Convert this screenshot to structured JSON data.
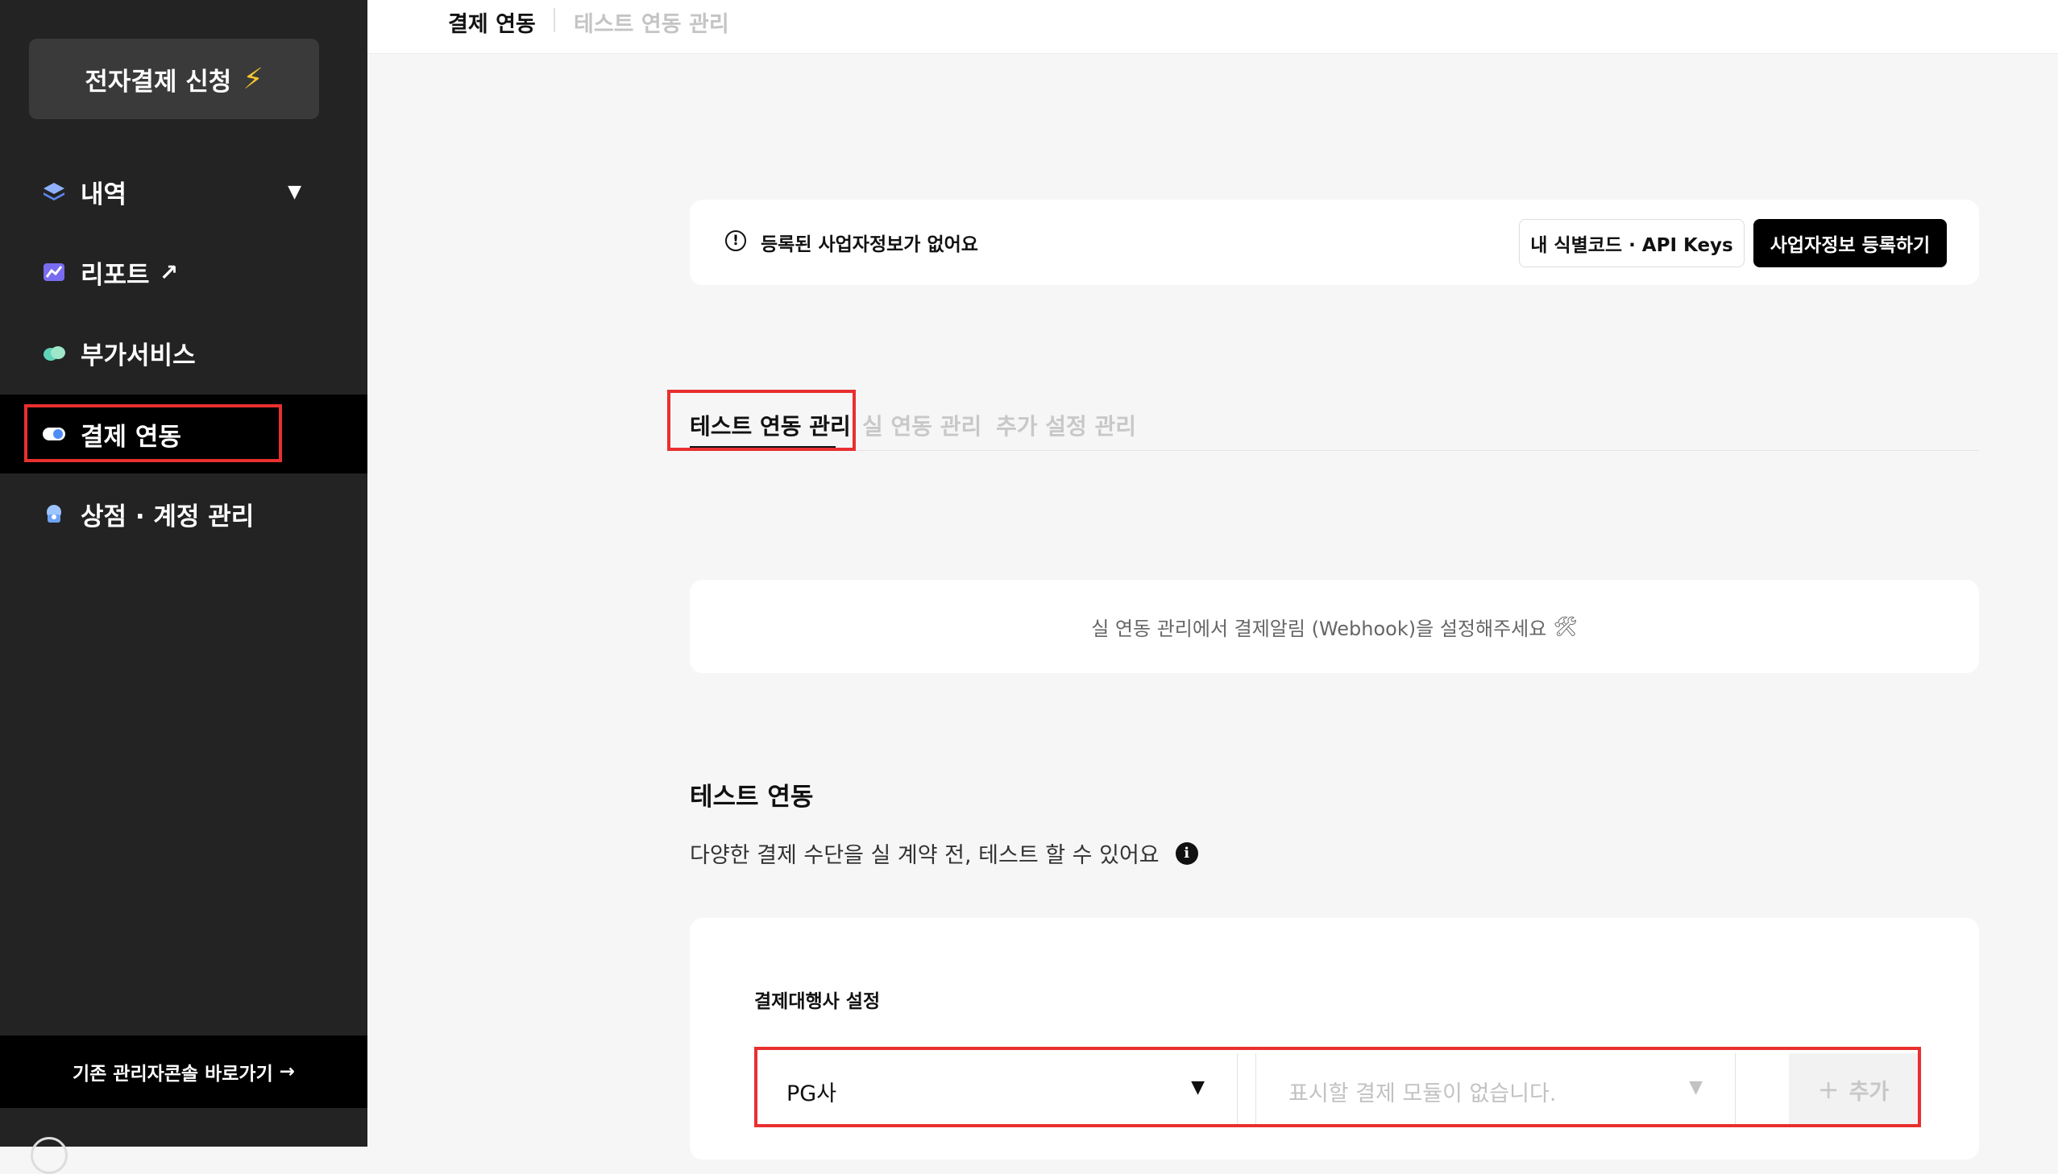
{
  "sidebar": {
    "apply_button": "전자결제 신청",
    "apply_icon": "⚡",
    "items": [
      {
        "label": "내역",
        "icon": "layers-icon"
      },
      {
        "label": "리포트",
        "icon": "chart-icon"
      },
      {
        "label": "부가서비스",
        "icon": "cloud-icon"
      },
      {
        "label": "결제 연동",
        "icon": "toggle-icon"
      },
      {
        "label": "상점 · 계정 관리",
        "icon": "store-icon"
      }
    ],
    "caret": "▼",
    "external_arrow": "↗",
    "legacy_link": "기존 관리자콘솔 바로가기",
    "legacy_arrow": "→"
  },
  "header": {
    "title": "결제 연동",
    "subtitle": "테스트 연동 관리"
  },
  "notice": {
    "icon_glyph": "!",
    "message": "등록된 사업자정보가 없어요",
    "api_keys_button": "내 식별코드 · API Keys",
    "register_button": "사업자정보 등록하기"
  },
  "tabs": [
    {
      "label": "테스트 연동 관리",
      "active": true
    },
    {
      "label": "실 연동 관리",
      "active": false
    },
    {
      "label": "추가 설정 관리",
      "active": false
    }
  ],
  "webhook_info": {
    "message": "실 연동 관리에서 결제알림 (Webhook)을 설정해주세요",
    "icon": "🛠"
  },
  "test_section": {
    "title": "테스트 연동",
    "description": "다양한 결제 수단을 실 계약 전, 테스트 할 수 있어요",
    "info_glyph": "i"
  },
  "pg_settings": {
    "label": "결제대행사 설정",
    "pg_select_value": "PG사",
    "module_placeholder": "표시할 결제 모듈이 없습니다.",
    "dropdown_glyph": "▼",
    "add_plus": "+",
    "add_button": "추가"
  },
  "colors": {
    "sidebar_bg": "#232323",
    "active_bg": "#000000",
    "highlight": "#e8302f",
    "accent_yellow": "#f7c531"
  }
}
